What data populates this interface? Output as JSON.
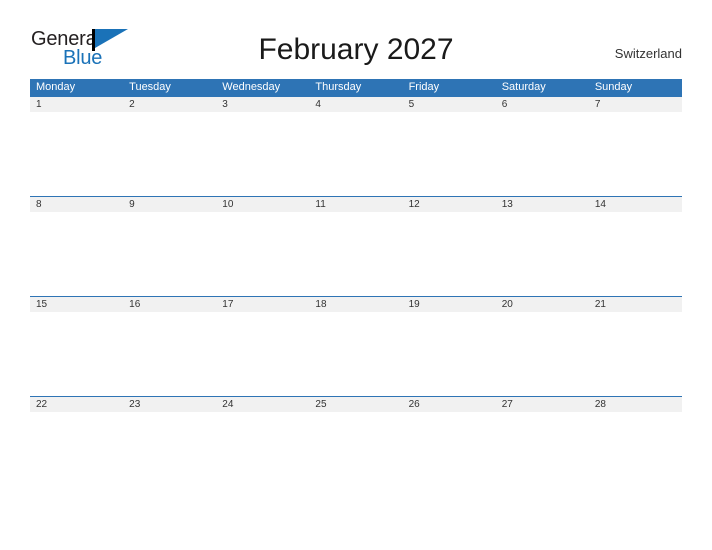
{
  "brand": {
    "name_part1": "General",
    "name_part2": "Blue",
    "flag_icon": "flag-icon",
    "primary_color": "#1a72b8"
  },
  "header": {
    "title": "February 2027",
    "location": "Switzerland"
  },
  "calendar": {
    "accent_color": "#2e74b5",
    "band_color": "#f1f1f1",
    "weekdays": [
      "Monday",
      "Tuesday",
      "Wednesday",
      "Thursday",
      "Friday",
      "Saturday",
      "Sunday"
    ],
    "weeks": [
      {
        "days": [
          {
            "date": "1"
          },
          {
            "date": "2"
          },
          {
            "date": "3"
          },
          {
            "date": "4"
          },
          {
            "date": "5"
          },
          {
            "date": "6"
          },
          {
            "date": "7"
          }
        ]
      },
      {
        "days": [
          {
            "date": "8"
          },
          {
            "date": "9"
          },
          {
            "date": "10"
          },
          {
            "date": "11"
          },
          {
            "date": "12"
          },
          {
            "date": "13"
          },
          {
            "date": "14"
          }
        ]
      },
      {
        "days": [
          {
            "date": "15"
          },
          {
            "date": "16"
          },
          {
            "date": "17"
          },
          {
            "date": "18"
          },
          {
            "date": "19"
          },
          {
            "date": "20"
          },
          {
            "date": "21"
          }
        ]
      },
      {
        "days": [
          {
            "date": "22"
          },
          {
            "date": "23"
          },
          {
            "date": "24"
          },
          {
            "date": "25"
          },
          {
            "date": "26"
          },
          {
            "date": "27"
          },
          {
            "date": "28"
          }
        ]
      }
    ]
  }
}
